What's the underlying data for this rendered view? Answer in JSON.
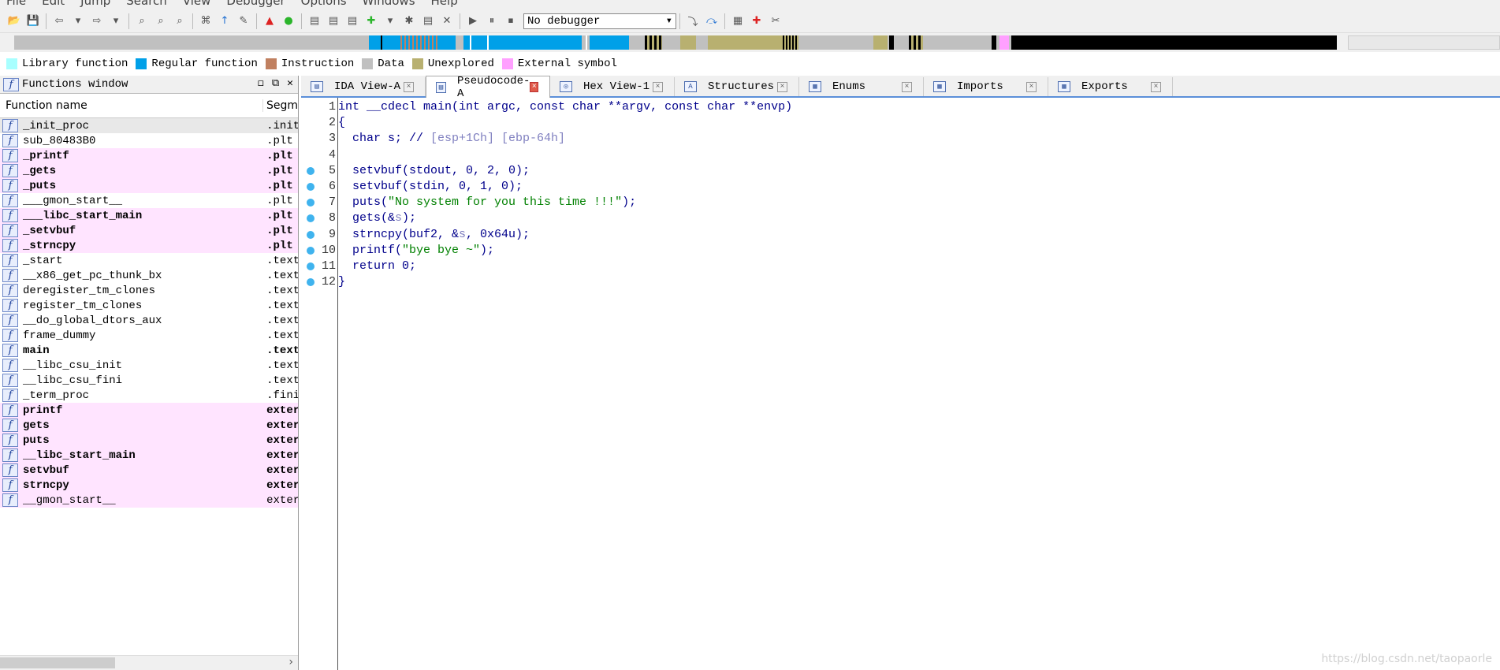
{
  "menu": [
    "File",
    "Edit",
    "Jump",
    "Search",
    "View",
    "Debugger",
    "Options",
    "Windows",
    "Help"
  ],
  "debugger": {
    "selected": "No debugger"
  },
  "legend": [
    {
      "label": "Library function",
      "color": "#a8ffff"
    },
    {
      "label": "Regular function",
      "color": "#00a0e8"
    },
    {
      "label": "Instruction",
      "color": "#c08060"
    },
    {
      "label": "Data",
      "color": "#c0c0c0"
    },
    {
      "label": "Unexplored",
      "color": "#b8b070"
    },
    {
      "label": "External symbol",
      "color": "#ffa0ff"
    }
  ],
  "functions_window": {
    "title": "Functions window",
    "col_name": "Function name",
    "col_segment": "Segm",
    "rows": [
      {
        "name": "_init_proc",
        "seg": ".init",
        "kind": "sel"
      },
      {
        "name": "sub_80483B0",
        "seg": ".plt",
        "kind": "normal"
      },
      {
        "name": "_printf",
        "seg": ".plt",
        "kind": "ext-bold"
      },
      {
        "name": "_gets",
        "seg": ".plt",
        "kind": "ext-bold"
      },
      {
        "name": "_puts",
        "seg": ".plt",
        "kind": "ext-bold"
      },
      {
        "name": "___gmon_start__",
        "seg": ".plt",
        "kind": "normal"
      },
      {
        "name": "___libc_start_main",
        "seg": ".plt",
        "kind": "ext-bold"
      },
      {
        "name": "_setvbuf",
        "seg": ".plt",
        "kind": "ext-bold"
      },
      {
        "name": "_strncpy",
        "seg": ".plt",
        "kind": "ext-bold"
      },
      {
        "name": "_start",
        "seg": ".text",
        "kind": "normal"
      },
      {
        "name": "__x86_get_pc_thunk_bx",
        "seg": ".text",
        "kind": "normal"
      },
      {
        "name": "deregister_tm_clones",
        "seg": ".text",
        "kind": "normal"
      },
      {
        "name": "register_tm_clones",
        "seg": ".text",
        "kind": "normal"
      },
      {
        "name": "__do_global_dtors_aux",
        "seg": ".text",
        "kind": "normal"
      },
      {
        "name": "frame_dummy",
        "seg": ".text",
        "kind": "normal"
      },
      {
        "name": "main",
        "seg": ".text",
        "kind": "bold"
      },
      {
        "name": "__libc_csu_init",
        "seg": ".text",
        "kind": "normal"
      },
      {
        "name": "__libc_csu_fini",
        "seg": ".text",
        "kind": "normal"
      },
      {
        "name": "_term_proc",
        "seg": ".fini",
        "kind": "normal"
      },
      {
        "name": "printf",
        "seg": "extern",
        "kind": "ext-bold"
      },
      {
        "name": "gets",
        "seg": "extern",
        "kind": "ext-bold"
      },
      {
        "name": "puts",
        "seg": "extern",
        "kind": "ext-bold"
      },
      {
        "name": "__libc_start_main",
        "seg": "extern",
        "kind": "ext-bold"
      },
      {
        "name": "setvbuf",
        "seg": "extern",
        "kind": "ext-bold"
      },
      {
        "name": "strncpy",
        "seg": "extern",
        "kind": "ext-bold"
      },
      {
        "name": "__gmon_start__",
        "seg": "extern",
        "kind": "ext"
      }
    ]
  },
  "tabs": [
    {
      "label": "IDA View-A",
      "active": false
    },
    {
      "label": "Pseudocode-A",
      "active": true
    },
    {
      "label": "Hex View-1",
      "active": false
    },
    {
      "label": "Structures",
      "active": false
    },
    {
      "label": "Enums",
      "active": false
    },
    {
      "label": "Imports",
      "active": false
    },
    {
      "label": "Exports",
      "active": false
    }
  ],
  "code": [
    {
      "n": "1",
      "bp": false,
      "parts": [
        {
          "t": "int __cdecl main(int argc, const char **argv, const char **envp)",
          "c": "code"
        }
      ]
    },
    {
      "n": "2",
      "bp": false,
      "parts": [
        {
          "t": "{",
          "c": "code"
        }
      ]
    },
    {
      "n": "3",
      "bp": false,
      "parts": [
        {
          "t": "  char s; // ",
          "c": "code"
        },
        {
          "t": "[esp+1Ch] [ebp-64h]",
          "c": "cmt"
        }
      ]
    },
    {
      "n": "4",
      "bp": false,
      "parts": [
        {
          "t": "",
          "c": "code"
        }
      ]
    },
    {
      "n": "5",
      "bp": true,
      "parts": [
        {
          "t": "  setvbuf(stdout, 0, 2, 0);",
          "c": "code"
        }
      ]
    },
    {
      "n": "6",
      "bp": true,
      "parts": [
        {
          "t": "  setvbuf(stdin, 0, 1, 0);",
          "c": "code"
        }
      ]
    },
    {
      "n": "7",
      "bp": true,
      "parts": [
        {
          "t": "  puts(",
          "c": "code"
        },
        {
          "t": "\"No system for you this time !!!\"",
          "c": "str"
        },
        {
          "t": ");",
          "c": "code"
        }
      ]
    },
    {
      "n": "8",
      "bp": true,
      "parts": [
        {
          "t": "  gets(&",
          "c": "code"
        },
        {
          "t": "s",
          "c": "cmt"
        },
        {
          "t": ");",
          "c": "code"
        }
      ]
    },
    {
      "n": "9",
      "bp": true,
      "parts": [
        {
          "t": "  strncpy(buf2, &",
          "c": "code"
        },
        {
          "t": "s",
          "c": "cmt"
        },
        {
          "t": ", 0x64u);",
          "c": "code"
        }
      ]
    },
    {
      "n": "10",
      "bp": true,
      "parts": [
        {
          "t": "  printf(",
          "c": "code"
        },
        {
          "t": "\"bye bye ~\"",
          "c": "str"
        },
        {
          "t": ");",
          "c": "code"
        }
      ]
    },
    {
      "n": "11",
      "bp": true,
      "parts": [
        {
          "t": "  return 0;",
          "c": "code"
        }
      ]
    },
    {
      "n": "12",
      "bp": true,
      "parts": [
        {
          "t": "}",
          "c": "code"
        }
      ]
    }
  ],
  "watermark": "https://blog.csdn.net/taopaorle"
}
